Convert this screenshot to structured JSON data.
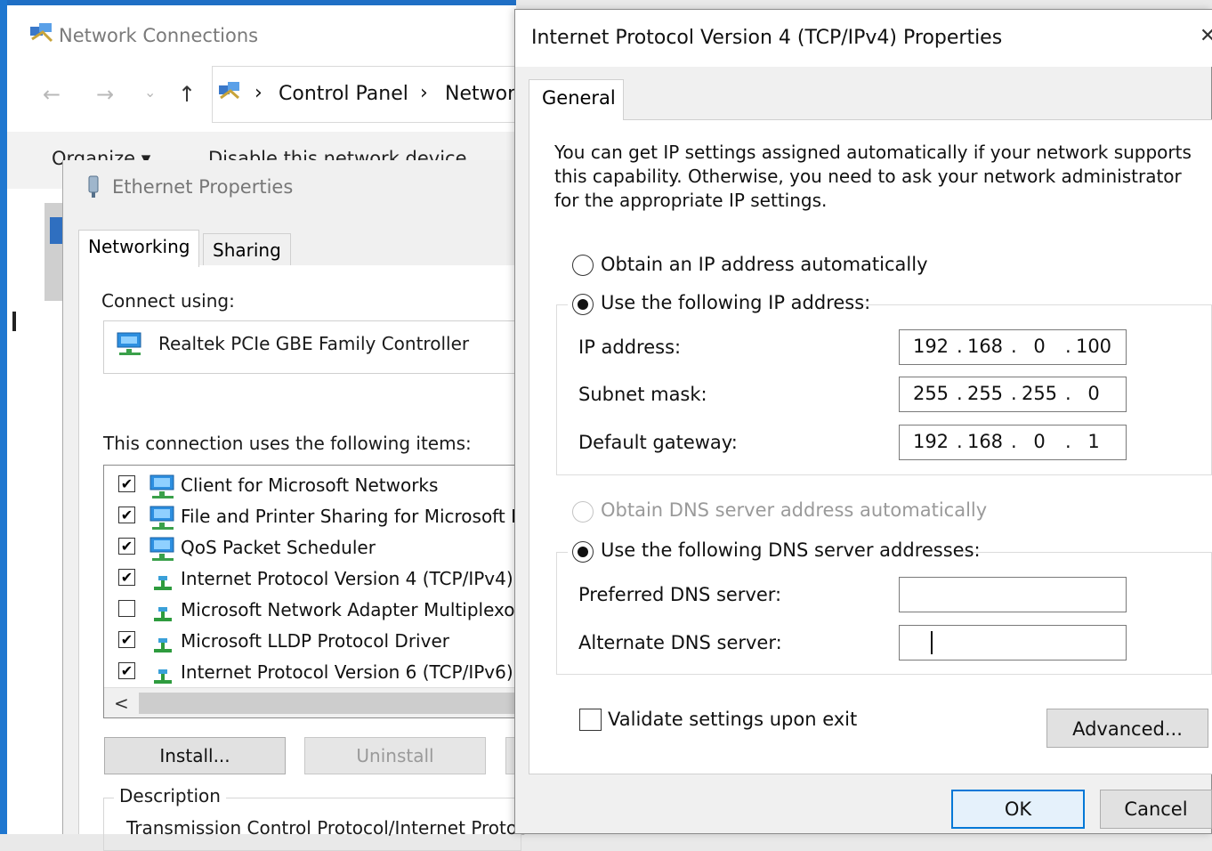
{
  "network_connections": {
    "title": "Network Connections",
    "breadcrumb": [
      "Control Panel",
      "Networ"
    ],
    "toolbar": [
      "Organize ▾",
      "Disable this network device"
    ]
  },
  "ethernet_properties": {
    "title": "Ethernet Properties",
    "tabs": [
      "Networking",
      "Sharing"
    ],
    "connect_using_label": "Connect using:",
    "adapter_name": "Realtek PCIe GBE Family Controller",
    "items_label": "This connection uses the following items:",
    "items": [
      {
        "label": "Client for Microsoft Networks",
        "checked": true,
        "icon": "network-client-icon"
      },
      {
        "label": "File and Printer Sharing for Microsoft Ne",
        "checked": true,
        "icon": "network-service-icon"
      },
      {
        "label": "QoS Packet Scheduler",
        "checked": true,
        "icon": "network-service-icon"
      },
      {
        "label": "Internet Protocol Version 4 (TCP/IPv4)",
        "checked": true,
        "icon": "protocol-icon"
      },
      {
        "label": "Microsoft Network Adapter Multiplexor",
        "checked": false,
        "icon": "protocol-icon"
      },
      {
        "label": "Microsoft LLDP Protocol Driver",
        "checked": true,
        "icon": "protocol-icon"
      },
      {
        "label": "Internet Protocol Version 6 (TCP/IPv6)",
        "checked": true,
        "icon": "protocol-icon"
      }
    ],
    "install_label": "Install...",
    "uninstall_label": "Uninstall",
    "description_label": "Description",
    "description_text": "Transmission Control Protocol/Internet Protoc"
  },
  "ipv4_properties": {
    "title": "Internet Protocol Version 4 (TCP/IPv4) Properties",
    "tab": "General",
    "intro": "You can get IP settings assigned automatically if your network supports this capability. Otherwise, you need to ask your network administrator for the appropriate IP settings.",
    "obtain_ip_auto": "Obtain an IP address automatically",
    "use_following_ip": "Use the following IP address:",
    "ip_address_label": "IP address:",
    "ip_address": [
      "192",
      "168",
      "0",
      "100"
    ],
    "subnet_mask_label": "Subnet mask:",
    "subnet_mask": [
      "255",
      "255",
      "255",
      "0"
    ],
    "default_gateway_label": "Default gateway:",
    "default_gateway": [
      "192",
      "168",
      "0",
      "1"
    ],
    "obtain_dns_auto": "Obtain DNS server address automatically",
    "use_following_dns": "Use the following DNS server addresses:",
    "preferred_dns_label": "Preferred DNS server:",
    "alternate_dns_label": "Alternate DNS server:",
    "validate_label": "Validate settings upon exit",
    "advanced_label": "Advanced...",
    "ok_label": "OK",
    "cancel_label": "Cancel"
  }
}
